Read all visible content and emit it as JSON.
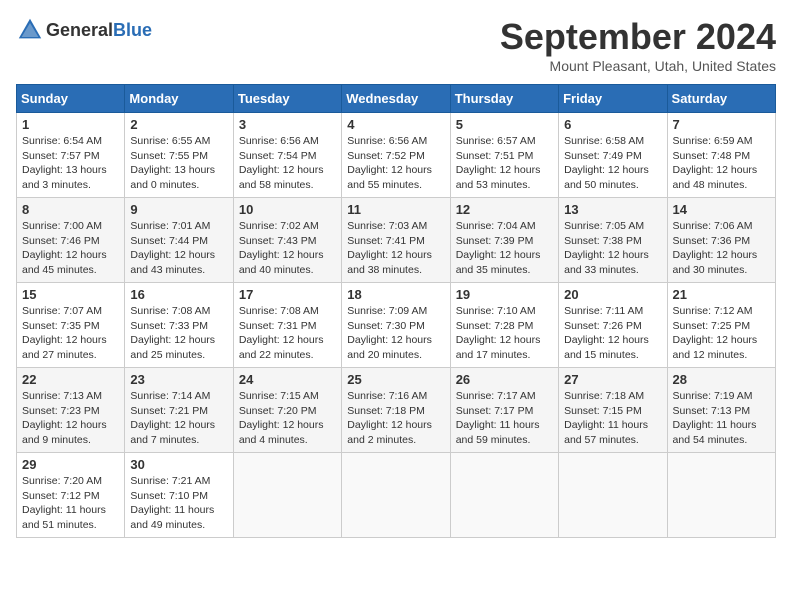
{
  "header": {
    "logo_general": "General",
    "logo_blue": "Blue",
    "month_title": "September 2024",
    "location": "Mount Pleasant, Utah, United States"
  },
  "weekdays": [
    "Sunday",
    "Monday",
    "Tuesday",
    "Wednesday",
    "Thursday",
    "Friday",
    "Saturday"
  ],
  "weeks": [
    [
      {
        "day": "1",
        "lines": [
          "Sunrise: 6:54 AM",
          "Sunset: 7:57 PM",
          "Daylight: 13 hours",
          "and 3 minutes."
        ]
      },
      {
        "day": "2",
        "lines": [
          "Sunrise: 6:55 AM",
          "Sunset: 7:55 PM",
          "Daylight: 13 hours",
          "and 0 minutes."
        ]
      },
      {
        "day": "3",
        "lines": [
          "Sunrise: 6:56 AM",
          "Sunset: 7:54 PM",
          "Daylight: 12 hours",
          "and 58 minutes."
        ]
      },
      {
        "day": "4",
        "lines": [
          "Sunrise: 6:56 AM",
          "Sunset: 7:52 PM",
          "Daylight: 12 hours",
          "and 55 minutes."
        ]
      },
      {
        "day": "5",
        "lines": [
          "Sunrise: 6:57 AM",
          "Sunset: 7:51 PM",
          "Daylight: 12 hours",
          "and 53 minutes."
        ]
      },
      {
        "day": "6",
        "lines": [
          "Sunrise: 6:58 AM",
          "Sunset: 7:49 PM",
          "Daylight: 12 hours",
          "and 50 minutes."
        ]
      },
      {
        "day": "7",
        "lines": [
          "Sunrise: 6:59 AM",
          "Sunset: 7:48 PM",
          "Daylight: 12 hours",
          "and 48 minutes."
        ]
      }
    ],
    [
      {
        "day": "8",
        "lines": [
          "Sunrise: 7:00 AM",
          "Sunset: 7:46 PM",
          "Daylight: 12 hours",
          "and 45 minutes."
        ]
      },
      {
        "day": "9",
        "lines": [
          "Sunrise: 7:01 AM",
          "Sunset: 7:44 PM",
          "Daylight: 12 hours",
          "and 43 minutes."
        ]
      },
      {
        "day": "10",
        "lines": [
          "Sunrise: 7:02 AM",
          "Sunset: 7:43 PM",
          "Daylight: 12 hours",
          "and 40 minutes."
        ]
      },
      {
        "day": "11",
        "lines": [
          "Sunrise: 7:03 AM",
          "Sunset: 7:41 PM",
          "Daylight: 12 hours",
          "and 38 minutes."
        ]
      },
      {
        "day": "12",
        "lines": [
          "Sunrise: 7:04 AM",
          "Sunset: 7:39 PM",
          "Daylight: 12 hours",
          "and 35 minutes."
        ]
      },
      {
        "day": "13",
        "lines": [
          "Sunrise: 7:05 AM",
          "Sunset: 7:38 PM",
          "Daylight: 12 hours",
          "and 33 minutes."
        ]
      },
      {
        "day": "14",
        "lines": [
          "Sunrise: 7:06 AM",
          "Sunset: 7:36 PM",
          "Daylight: 12 hours",
          "and 30 minutes."
        ]
      }
    ],
    [
      {
        "day": "15",
        "lines": [
          "Sunrise: 7:07 AM",
          "Sunset: 7:35 PM",
          "Daylight: 12 hours",
          "and 27 minutes."
        ]
      },
      {
        "day": "16",
        "lines": [
          "Sunrise: 7:08 AM",
          "Sunset: 7:33 PM",
          "Daylight: 12 hours",
          "and 25 minutes."
        ]
      },
      {
        "day": "17",
        "lines": [
          "Sunrise: 7:08 AM",
          "Sunset: 7:31 PM",
          "Daylight: 12 hours",
          "and 22 minutes."
        ]
      },
      {
        "day": "18",
        "lines": [
          "Sunrise: 7:09 AM",
          "Sunset: 7:30 PM",
          "Daylight: 12 hours",
          "and 20 minutes."
        ]
      },
      {
        "day": "19",
        "lines": [
          "Sunrise: 7:10 AM",
          "Sunset: 7:28 PM",
          "Daylight: 12 hours",
          "and 17 minutes."
        ]
      },
      {
        "day": "20",
        "lines": [
          "Sunrise: 7:11 AM",
          "Sunset: 7:26 PM",
          "Daylight: 12 hours",
          "and 15 minutes."
        ]
      },
      {
        "day": "21",
        "lines": [
          "Sunrise: 7:12 AM",
          "Sunset: 7:25 PM",
          "Daylight: 12 hours",
          "and 12 minutes."
        ]
      }
    ],
    [
      {
        "day": "22",
        "lines": [
          "Sunrise: 7:13 AM",
          "Sunset: 7:23 PM",
          "Daylight: 12 hours",
          "and 9 minutes."
        ]
      },
      {
        "day": "23",
        "lines": [
          "Sunrise: 7:14 AM",
          "Sunset: 7:21 PM",
          "Daylight: 12 hours",
          "and 7 minutes."
        ]
      },
      {
        "day": "24",
        "lines": [
          "Sunrise: 7:15 AM",
          "Sunset: 7:20 PM",
          "Daylight: 12 hours",
          "and 4 minutes."
        ]
      },
      {
        "day": "25",
        "lines": [
          "Sunrise: 7:16 AM",
          "Sunset: 7:18 PM",
          "Daylight: 12 hours",
          "and 2 minutes."
        ]
      },
      {
        "day": "26",
        "lines": [
          "Sunrise: 7:17 AM",
          "Sunset: 7:17 PM",
          "Daylight: 11 hours",
          "and 59 minutes."
        ]
      },
      {
        "day": "27",
        "lines": [
          "Sunrise: 7:18 AM",
          "Sunset: 7:15 PM",
          "Daylight: 11 hours",
          "and 57 minutes."
        ]
      },
      {
        "day": "28",
        "lines": [
          "Sunrise: 7:19 AM",
          "Sunset: 7:13 PM",
          "Daylight: 11 hours",
          "and 54 minutes."
        ]
      }
    ],
    [
      {
        "day": "29",
        "lines": [
          "Sunrise: 7:20 AM",
          "Sunset: 7:12 PM",
          "Daylight: 11 hours",
          "and 51 minutes."
        ]
      },
      {
        "day": "30",
        "lines": [
          "Sunrise: 7:21 AM",
          "Sunset: 7:10 PM",
          "Daylight: 11 hours",
          "and 49 minutes."
        ]
      },
      null,
      null,
      null,
      null,
      null
    ]
  ]
}
